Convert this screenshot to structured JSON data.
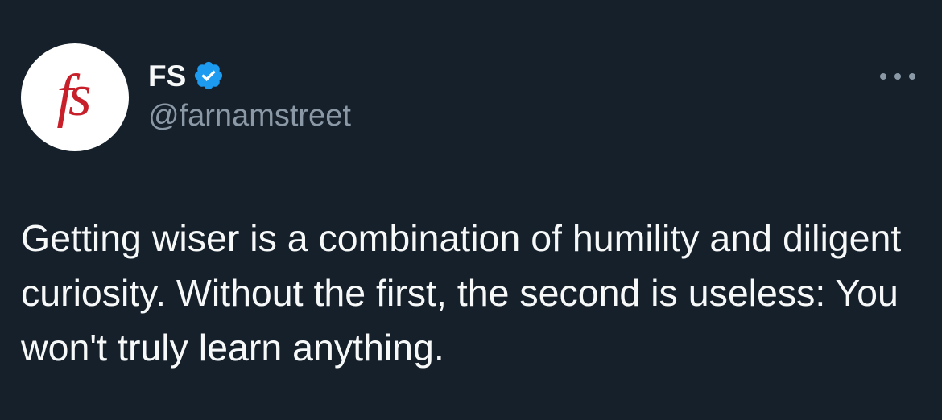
{
  "author": {
    "avatar_text": "fs",
    "display_name": "FS",
    "handle": "@farnamstreet",
    "verified": true
  },
  "tweet": {
    "text": "Getting wiser is a combination of humility and diligent curiosity. Without the first, the second is useless: You won't truly learn anything."
  },
  "icons": {
    "verified": "verified-badge-icon",
    "more": "more-options-icon"
  },
  "colors": {
    "background": "#15202b",
    "text_primary": "#f7f9f9",
    "text_secondary": "#8b98a5",
    "verified_blue": "#1d9bf0",
    "avatar_logo": "#c8202b"
  }
}
